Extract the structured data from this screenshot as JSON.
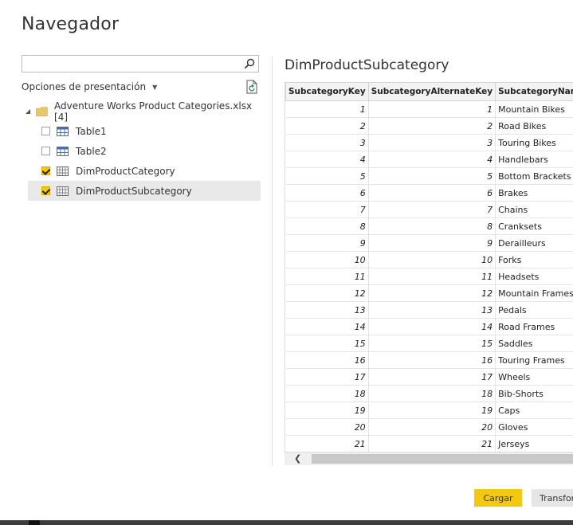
{
  "dialog": {
    "title": "Navegador"
  },
  "search": {
    "value": "",
    "placeholder": ""
  },
  "options": {
    "label": "Opciones de presentación"
  },
  "tree": {
    "root_label": "Adventure Works Product Categories.xlsx [4]",
    "items": [
      {
        "label": "Table1",
        "checked": false,
        "icon": "table-icon"
      },
      {
        "label": "Table2",
        "checked": false,
        "icon": "table-icon"
      },
      {
        "label": "DimProductCategory",
        "checked": true,
        "icon": "sheet-icon"
      },
      {
        "label": "DimProductSubcategory",
        "checked": true,
        "icon": "sheet-icon",
        "selected": true
      }
    ]
  },
  "preview": {
    "title": "DimProductSubcategory",
    "columns": [
      "SubcategoryKey",
      "SubcategoryAlternateKey",
      "SubcategoryName"
    ],
    "rows": [
      [
        "1",
        "1",
        "Mountain Bikes"
      ],
      [
        "2",
        "2",
        "Road Bikes"
      ],
      [
        "3",
        "3",
        "Touring Bikes"
      ],
      [
        "4",
        "4",
        "Handlebars"
      ],
      [
        "5",
        "5",
        "Bottom Brackets"
      ],
      [
        "6",
        "6",
        "Brakes"
      ],
      [
        "7",
        "7",
        "Chains"
      ],
      [
        "8",
        "8",
        "Cranksets"
      ],
      [
        "9",
        "9",
        "Derailleurs"
      ],
      [
        "10",
        "10",
        "Forks"
      ],
      [
        "11",
        "11",
        "Headsets"
      ],
      [
        "12",
        "12",
        "Mountain Frames"
      ],
      [
        "13",
        "13",
        "Pedals"
      ],
      [
        "14",
        "14",
        "Road Frames"
      ],
      [
        "15",
        "15",
        "Saddles"
      ],
      [
        "16",
        "16",
        "Touring Frames"
      ],
      [
        "17",
        "17",
        "Wheels"
      ],
      [
        "18",
        "18",
        "Bib-Shorts"
      ],
      [
        "19",
        "19",
        "Caps"
      ],
      [
        "20",
        "20",
        "Gloves"
      ],
      [
        "21",
        "21",
        "Jerseys"
      ]
    ]
  },
  "buttons": {
    "load": "Cargar",
    "transform": "Transform"
  },
  "colors": {
    "accent": "#f2c811",
    "selected_row": "#e9e9e9"
  }
}
